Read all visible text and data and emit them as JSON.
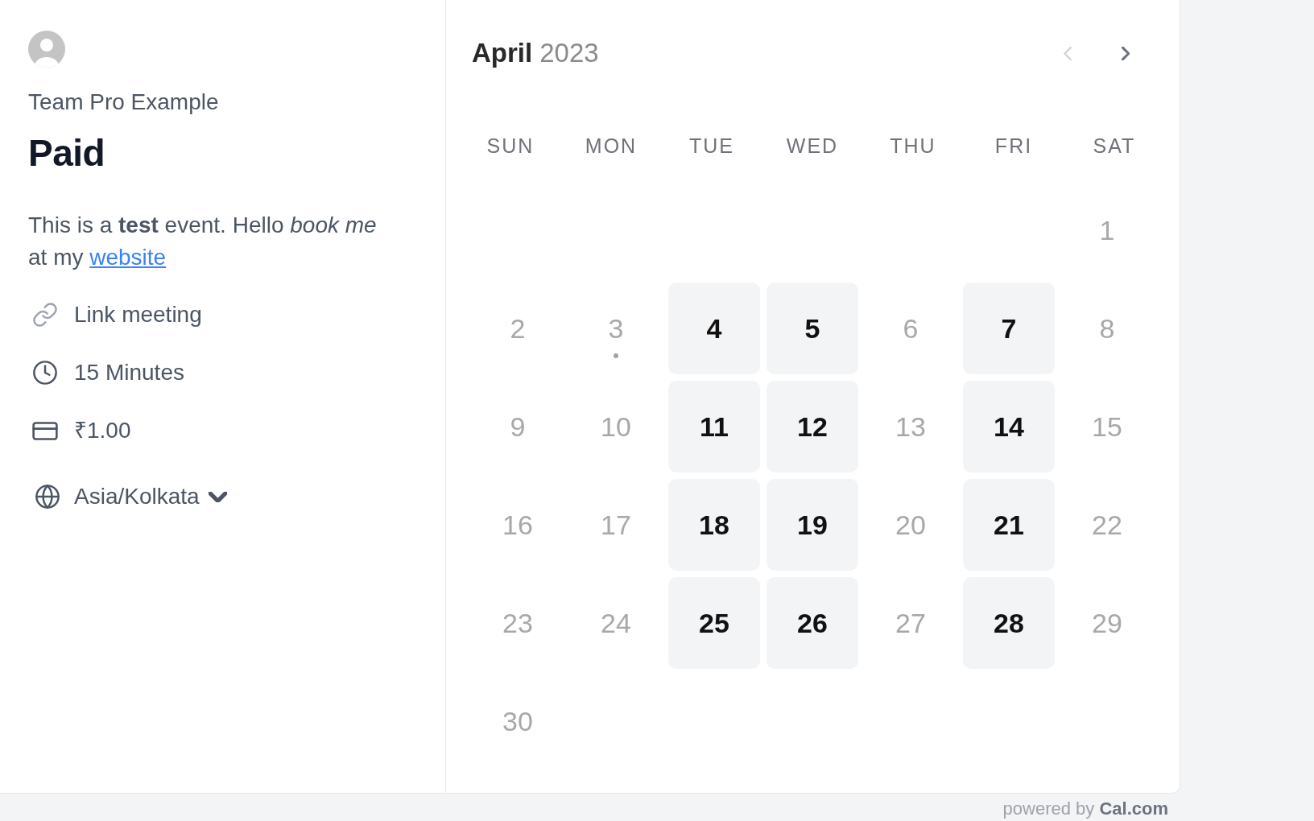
{
  "profile": {
    "name": "Team Pro Example"
  },
  "event": {
    "title": "Paid",
    "description": "This is a **test** event. Hello *book me* at my",
    "description_link": "website",
    "details": [
      {
        "kind": "location",
        "text": "Link meeting"
      },
      {
        "kind": "duration",
        "text": "15 Minutes"
      },
      {
        "kind": "price",
        "text": "₹1.00"
      }
    ],
    "timezone": "Asia/Kolkata"
  },
  "calendar": {
    "month": "April",
    "year": "2023",
    "nav": [
      {
        "kind": "prev",
        "disabled": true
      },
      {
        "kind": "next",
        "disabled": false
      }
    ],
    "weekdays": [
      "SUN",
      "MON",
      "TUE",
      "WED",
      "THU",
      "FRI",
      "SAT"
    ],
    "weeks": [
      {
        "days": [
          {
            "label": "1",
            "available": false,
            "today": false
          }
        ]
      },
      {
        "days": [
          {
            "label": "2",
            "available": false,
            "today": false
          },
          {
            "label": "3",
            "available": false,
            "today": true
          },
          {
            "label": "4",
            "available": true,
            "today": false
          },
          {
            "label": "5",
            "available": true,
            "today": false
          },
          {
            "label": "6",
            "available": false,
            "today": false
          },
          {
            "label": "7",
            "available": true,
            "today": false
          },
          {
            "label": "8",
            "available": false,
            "today": false
          }
        ]
      },
      {
        "days": [
          {
            "label": "9",
            "available": false,
            "today": false
          },
          {
            "label": "10",
            "available": false,
            "today": false
          },
          {
            "label": "11",
            "available": true,
            "today": false
          },
          {
            "label": "12",
            "available": true,
            "today": false
          },
          {
            "label": "13",
            "available": false,
            "today": false
          },
          {
            "label": "14",
            "available": true,
            "today": false
          },
          {
            "label": "15",
            "available": false,
            "today": false
          }
        ]
      },
      {
        "days": [
          {
            "label": "16",
            "available": false,
            "today": false
          },
          {
            "label": "17",
            "available": false,
            "today": false
          },
          {
            "label": "18",
            "available": true,
            "today": false
          },
          {
            "label": "19",
            "available": true,
            "today": false
          },
          {
            "label": "20",
            "available": false,
            "today": false
          },
          {
            "label": "21",
            "available": true,
            "today": false
          },
          {
            "label": "22",
            "available": false,
            "today": false
          }
        ]
      },
      {
        "days": [
          {
            "label": "23",
            "available": false,
            "today": false
          },
          {
            "label": "24",
            "available": false,
            "today": false
          },
          {
            "label": "25",
            "available": true,
            "today": false
          },
          {
            "label": "26",
            "available": true,
            "today": false
          },
          {
            "label": "27",
            "available": false,
            "today": false
          },
          {
            "label": "28",
            "available": true,
            "today": false
          },
          {
            "label": "29",
            "available": false,
            "today": false
          }
        ]
      },
      {
        "days": [
          {
            "label": "30",
            "available": false,
            "today": false
          }
        ]
      }
    ]
  },
  "footer": {
    "text": "powered by **Cal.com**"
  }
}
